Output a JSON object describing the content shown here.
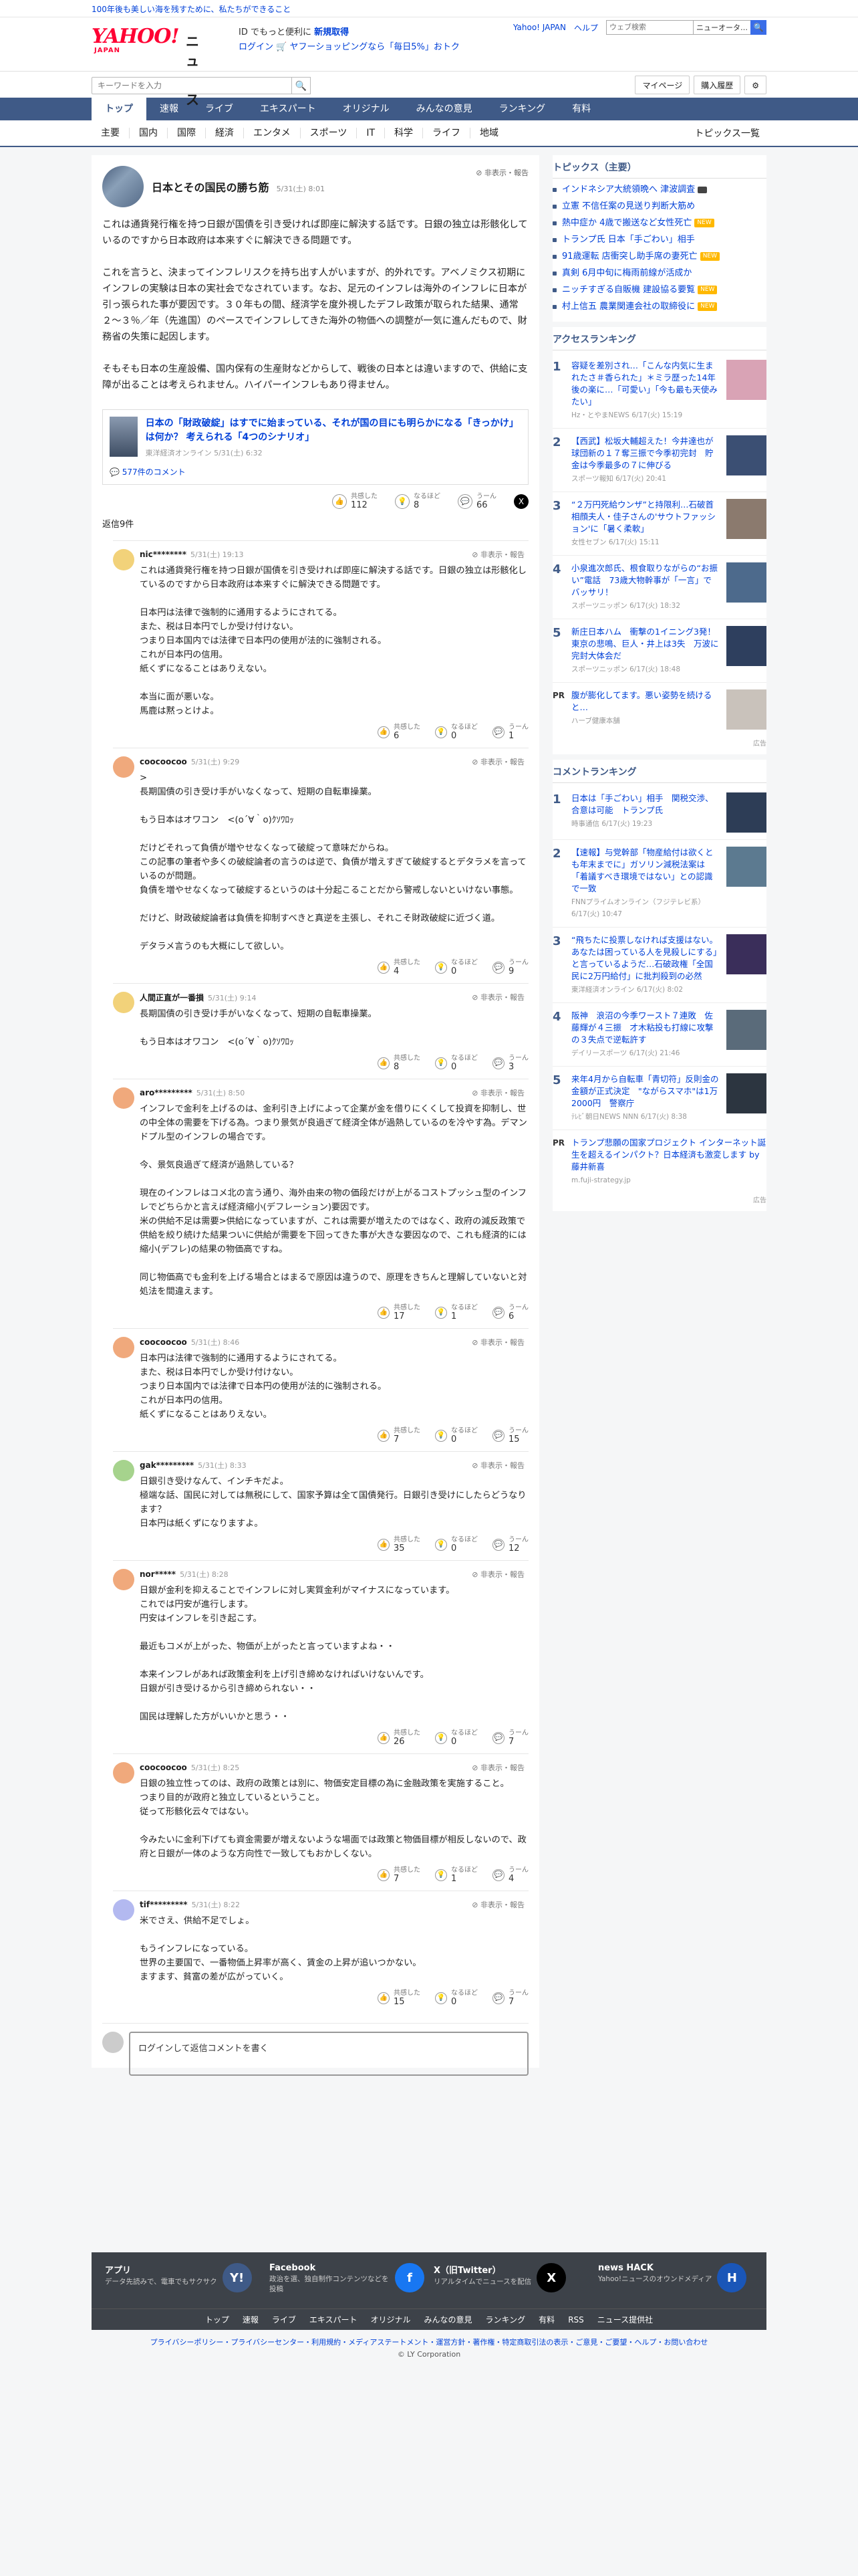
{
  "top_banner": {
    "text": "100年後も美しい海を残すために、私たちができること"
  },
  "header": {
    "logo_text": "YAHOO!",
    "logo_sub": "JAPAN",
    "service_name": "ニュース",
    "promo_line1": "ID でもっと便利に",
    "promo_line1_link": "新規取得",
    "promo_line2_login": "ログイン",
    "promo_line2_text": "ヤフーショッピングなら「毎日5%」おトク",
    "links": [
      "Yahoo! JAPAN",
      "ヘルプ"
    ],
    "search_placeholder": "ウェブ検索",
    "search_select": "ニューオータ…",
    "search_button": "🔍"
  },
  "subbar": {
    "search_placeholder": "キーワードを入力",
    "mypage": "マイページ",
    "history": "購入履歴",
    "settings_icon": "gear-icon"
  },
  "global_nav": [
    "トップ",
    "速報",
    "ライブ",
    "エキスパート",
    "オリジナル",
    "みんなの意見",
    "ランキング",
    "有料"
  ],
  "category_nav": [
    "主要",
    "国内",
    "国際",
    "経済",
    "エンタメ",
    "スポーツ",
    "IT",
    "科学",
    "ライフ",
    "地域"
  ],
  "category_nav_right": "トピックス一覧",
  "article": {
    "title": "日本とその国民の勝ち筋",
    "time": "5/31(土) 8:01",
    "nonpub": "非表示・報告",
    "paragraphs": [
      "これは通貨発行権を持つ日銀が国債を引き受ければ即座に解決する話です。日銀の独立は形骸化しているのですから日本政府は本来すぐに解決できる問題です。",
      "これを言うと、決まってインフレリスクを持ち出す人がいますが、的外れです。アベノミクス初期にインフレの実験は日本の実社会でなされています。なお、足元のインフレは海外のインフレに日本が引っ張られた事が要因です。３０年もの間、経済学を度外視したデフレ政策が取られた結果、通常２〜３％／年（先進国）のペースでインフレしてきた海外の物価への調整が一気に進んだもので、財務省の失策に起因します。",
      "そもそも日本の生産設備、国内保有の生産財などからして、戦後の日本とは違いますので、供給に支障が出ることは考えられません。ハイパーインフレもあり得ません。"
    ],
    "card_title": "日本の「財政破綻」はすでに始まっている、それが国の目にも明らかになる「きっかけ」は何か？ 考えられる「4つのシナリオ」",
    "card_source": "東洋経済オンライン 5/31(土) 6:32",
    "card_comments": "577件のコメント",
    "reactions": [
      {
        "label": "共感した",
        "value": "112",
        "icon": "thumbs-up-icon"
      },
      {
        "label": "なるほど",
        "value": "8",
        "icon": "lightbulb-icon"
      },
      {
        "label": "うーん",
        "value": "66",
        "icon": "speech-icon"
      }
    ],
    "reply_count": "返信9件"
  },
  "comments": [
    {
      "user": "nic********",
      "time": "5/31(土) 19:13",
      "avatar_color": "#f2d27a",
      "text": "これは通貨発行権を持つ日銀が国債を引き受ければ即座に解決する話です。日銀の独立は形骸化しているのですから日本政府は本来すぐに解決できる問題です。\n\n日本円は法律で強制的に通用するようにされてる。\nまた、税は日本円でしか受け付けない。\nつまり日本国内では法律で日本円の使用が法的に強制される。\nこれが日本円の信用。\n紙くずになることはありえない。\n\n本当に面が悪いな。\n馬鹿は黙っとけよ。",
      "r": [
        "6",
        "0",
        "1"
      ]
    },
    {
      "user": "coocoocoo",
      "time": "5/31(土) 9:29",
      "avatar_color": "#f0a97c",
      "text": ">\n長期国債の引き受け手がいなくなって、短期の自転車操業。\n\nもう日本はオワコン　<(o´∀｀o)ｸｿﾜﾛｯ\n\nだけどそれって負債が増やせなくなって破綻って意味だからね。\nこの記事の筆者や多くの破綻論者の言うのは逆で、負債が増えすぎて破綻するとデタラメを言っているのが問題。\n負債を増やせなくなって破綻するというのは十分起こることだから警戒しないといけない事態。\n\nだけど、財政破綻論者は負債を抑制すべきと真逆を主張し、それこそ財政破綻に近づく道。\n\nデタラメ言うのも大概にして欲しい。",
      "r": [
        "4",
        "0",
        "9"
      ]
    },
    {
      "user": "人間正直が一番損",
      "time": "5/31(土) 9:14",
      "avatar_color": "#f2d27a",
      "text": "長期国債の引き受け手がいなくなって、短期の自転車操業。\n\nもう日本はオワコン　<(o´∀｀o)ｸｿﾜﾛｯ",
      "r": [
        "8",
        "0",
        "3"
      ]
    },
    {
      "user": "aro*********",
      "time": "5/31(土) 8:50",
      "avatar_color": "#f0a97c",
      "text": "インフレで金利を上げるのは、金利引き上げによって企業が金を借りにくくして投資を抑制し、世の中全体の需要を下げる為。つまり景気が良過ぎて経済全体が過熱しているのを冷やす為。デマンドプル型のインフレの場合です。\n\n今、景気良過ぎて経済が過熱している？\n\n現在のインフレはコメ北の言う通り、海外由来の物の価段だけが上がるコストプッシュ型のインフレでどちらかと言えば経済縮小(デフレーション)要因です。\n米の供給不足は需要>供給になっていますが、これは需要が増えたのではなく、政府の減反政策で供給を絞り続けた結果ついに供給が需要を下回ってきた事が大きな要因なので、これも経済的には縮小(デフレ)の結果の物価高ですね。\n\n同じ物価高でも金利を上げる場合とはまるで原因は違うので、原理をきちんと理解していないと対処法を間違えます。",
      "r": [
        "17",
        "1",
        "6"
      ]
    },
    {
      "user": "coocoocoo",
      "time": "5/31(土) 8:46",
      "avatar_color": "#f0a97c",
      "text": "日本円は法律で強制的に通用するようにされてる。\nまた、税は日本円でしか受け付けない。\nつまり日本国内では法律で日本円の使用が法的に強制される。\nこれが日本円の信用。\n紙くずになることはありえない。",
      "r": [
        "7",
        "0",
        "15"
      ]
    },
    {
      "user": "gak*********",
      "time": "5/31(土) 8:33",
      "avatar_color": "#a6d38d",
      "text": "日銀引き受けなんて、インチキだよ。\n極端な話、国民に対しては無税にして、国家予算は全て国債発行。日銀引き受けにしたらどうなります？\n日本円は紙くずになりますよ。",
      "r": [
        "35",
        "0",
        "12"
      ]
    },
    {
      "user": "nor*****",
      "time": "5/31(土) 8:28",
      "avatar_color": "#f0a97c",
      "text": "日銀が金利を抑えることでインフレに対し実質金利がマイナスになっています。\nこれでは円安が進行します。\n円安はインフレを引き起こす。\n\n最近もコメが上がった、物価が上がったと言っていますよね・・\n\n本来インフレがあれば政策金利を上げ引き締めなければいけないんです。\n日銀が引き受けるから引き締められない・・\n\n国民は理解した方がいいかと思う・・",
      "r": [
        "26",
        "0",
        "7"
      ]
    },
    {
      "user": "coocoocoo",
      "time": "5/31(土) 8:25",
      "avatar_color": "#f0a97c",
      "text": "日銀の独立性ってのは、政府の政策とは別に、物価安定目標の為に金融政策を実施すること。\nつまり目的が政府と独立しているということ。\n従って形骸化云々ではない。\n\n今みたいに金利下げても資金需要が増えないような場面では政策と物価目標が相反しないので、政府と日銀が一体のような方向性で一致してもおかしくない。",
      "r": [
        "7",
        "1",
        "4"
      ]
    },
    {
      "user": "tif*********",
      "time": "5/31(土) 8:22",
      "avatar_color": "#b3b9f0",
      "text": "米でさえ、供給不足でしょ。\n\nもうインフレになっている。\n世界の主要国で、一番物価上昇率が高く、賃金の上昇が追いつかない。\nますます、貧富の差が広がっていく。",
      "r": [
        "15",
        "0",
        "7"
      ]
    }
  ],
  "comment_reaction_labels": [
    "共感した",
    "なるほど",
    "うーん"
  ],
  "login_prompt": "ログインして返信コメントを書く",
  "sidebar": {
    "topics_title": "トピックス（主要）",
    "topics": [
      {
        "text": "インドネシア大統領晩へ 津波調査",
        "badge": "camera"
      },
      {
        "text": "立憲 不信任案の見送り判断大筋め",
        "badge": ""
      },
      {
        "text": "熱中症か 4歳で搬送など女性死亡",
        "badge": "NEW"
      },
      {
        "text": "トランプ氏 日本「手ごわい」相手",
        "badge": ""
      },
      {
        "text": "91歳運転 店衝突し助手席の妻死亡",
        "badge": "NEW"
      },
      {
        "text": "真剣 6月中旬に梅雨前線が活成か",
        "badge": ""
      },
      {
        "text": "ニッチすぎる自販機 建設協る要覧",
        "badge": "NEW"
      },
      {
        "text": "村上信五 農業関連会社の取締役に",
        "badge": "NEW"
      }
    ],
    "access_title": "アクセスランキング",
    "access": [
      {
        "text": "容疑を差別され…「こんな内気に生まれたさ＃香られた」＊ミラ歴った14年後の楽に…「可愛い」「今も最も天使みたい」",
        "source": "Hz・とやまNEWS 6/17(火) 15:19",
        "color": "#d9a3b5"
      },
      {
        "text": "【西武】松坂大輔超えた！今井達也が球団新の１７奪三振で今季初完封　貯金は今季最多の７に伸びる",
        "source": "スポーツ報知 6/17(火) 20:41",
        "color": "#3b4f73"
      },
      {
        "text": "“２万円死給ウンザ”と持限利…石破首相顔夫人・佳子さんの'サウトファッション'に「暑く柔軟」",
        "source": "女性セブン 6/17(火) 15:11",
        "color": "#8b7a6e"
      },
      {
        "text": "小泉進次郎氏、根食取りながらの“お振い”電話　73歳大物幹事が「一言」でバッサリ！",
        "source": "スポーツニッポン 6/17(火) 18:32",
        "color": "#4d6a8c"
      },
      {
        "text": "新庄日本ハム　衝撃の1イニング3発！東京の悲鳴、巨人・井上は3失　万波に完封大体会だ",
        "source": "スポーツニッポン 6/17(火) 18:48",
        "color": "#2e3f5e"
      }
    ],
    "pr1_text": "腹が膨化してます。悪い姿勢を続けると…",
    "pr1_source": "ハーブ健康本舗",
    "comment_rank_title": "コメントランキング",
    "comment_rank": [
      {
        "text": "日本は「手ごわい」相手　関税交渉、合意は可能　トランプ氏",
        "source": "時事通信 6/17(火) 19:23",
        "color": "#2d3d56"
      },
      {
        "text": "【速報】与党幹部「物産給付は欲くとも年末までに」ガソリン減税法案は「着議すべき環境ではない」との認識で一致",
        "source": "FNNプライムオンライン（フジテレビ系） 6/17(火) 10:47",
        "color": "#5c7a90"
      },
      {
        "text": "“飛ちたに投票しなければ支援はない。あなたは困っている人を見殺しにする」と言っているようだ…石破政権「全国民に2万円給付」に批判殺到の必然",
        "source": "東洋経済オンライン 6/17(火) 8:02",
        "color": "#3a2e5a"
      },
      {
        "text": "阪神　浪沼の今季ワースト７連敗　佐藤輝が４三振　才木粘投も打線に攻撃の３失点で逆転許す",
        "source": "デイリースポーツ 6/17(火) 21:46",
        "color": "#5a6b7a"
      },
      {
        "text": "来年4月から自転車「青切符」反則金の金額が正式決定　\"ながらスマホ\"は1万2000円　警察庁",
        "source": "ﾃﾚﾋﾞ朝日NEWS NNN 6/17(火) 8:38",
        "color": "#2c3540"
      }
    ],
    "pr2_text": "トランプ悲願の国家プロジェクト インターネット誕生を超えるインパクト？日本経済も激変します by藤井新喜",
    "pr2_source": "m.fuji-strategy.jp",
    "ad_label": "広告"
  },
  "footer": {
    "apps": [
      {
        "title": "アプリ",
        "desc": "データ先読みで、電車でもサクサク",
        "icon": "Y!"
      },
      {
        "title": "Facebook",
        "desc": "政治を選、独自制作コンテンツなどを投稿",
        "icon": "f"
      },
      {
        "title": "X（旧Twitter）",
        "desc": "リアルタイムでニュースを配信",
        "icon": "X"
      },
      {
        "title": "news HACK",
        "desc": "Yahoo!ニュースのオウンドメディア",
        "icon": "H"
      }
    ],
    "nav": [
      "トップ",
      "速報",
      "ライブ",
      "エキスパート",
      "オリジナル",
      "みんなの意見",
      "ランキング",
      "有料",
      "RSS",
      "ニュース提供社"
    ],
    "links": "プライバシーポリシー・プライバシーセンター・利用規約・メディアステートメント・運営方針・著作権・特定商取引法の表示・ご意見・ご要望・ヘルプ・お問い合わせ",
    "copyright": "© LY Corporation"
  }
}
